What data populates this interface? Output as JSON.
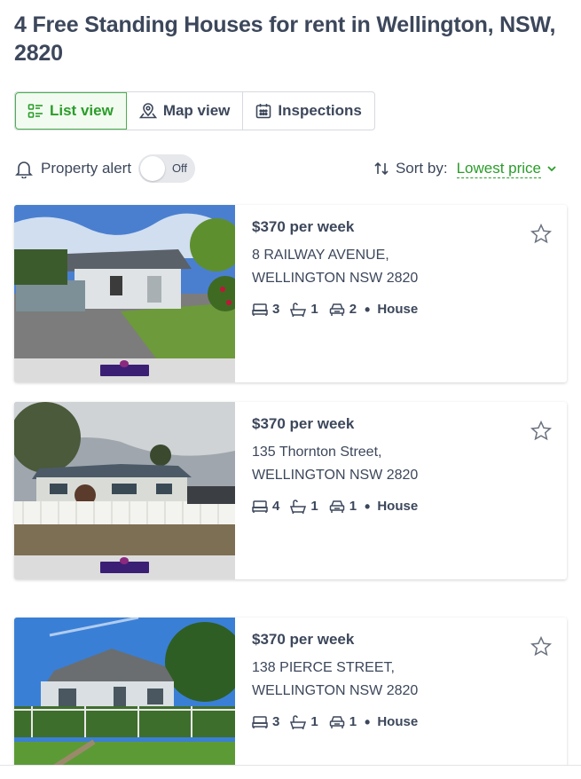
{
  "page": {
    "title": "4 Free Standing Houses for rent in Wellington, NSW, 2820"
  },
  "view_tabs": [
    {
      "label": "List view",
      "icon": "list-view-icon",
      "active": true
    },
    {
      "label": "Map view",
      "icon": "map-pin-icon",
      "active": false
    },
    {
      "label": "Inspections",
      "icon": "calendar-icon",
      "active": false
    }
  ],
  "alert": {
    "label": "Property alert",
    "toggle_text": "Off",
    "icon": "bell-icon"
  },
  "sort": {
    "label": "Sort by:",
    "value": "Lowest price",
    "icon": "sort-arrows-icon"
  },
  "listings": [
    {
      "price": "$370 per week",
      "address_line1": "8 RAILWAY AVENUE,",
      "address_line2": "WELLINGTON NSW 2820",
      "beds": "3",
      "baths": "1",
      "parking": "2",
      "type": "House"
    },
    {
      "price": "$370 per week",
      "address_line1": "135 Thornton Street,",
      "address_line2": "WELLINGTON NSW 2820",
      "beds": "4",
      "baths": "1",
      "parking": "1",
      "type": "House"
    },
    {
      "price": "$370 per week",
      "address_line1": "138 PIERCE STREET,",
      "address_line2": "WELLINGTON NSW 2820",
      "beds": "3",
      "baths": "1",
      "parking": "1",
      "type": "House"
    }
  ],
  "colors": {
    "accent_green": "#2a9d2a",
    "text": "#3c475b",
    "border": "#d6d9df"
  }
}
